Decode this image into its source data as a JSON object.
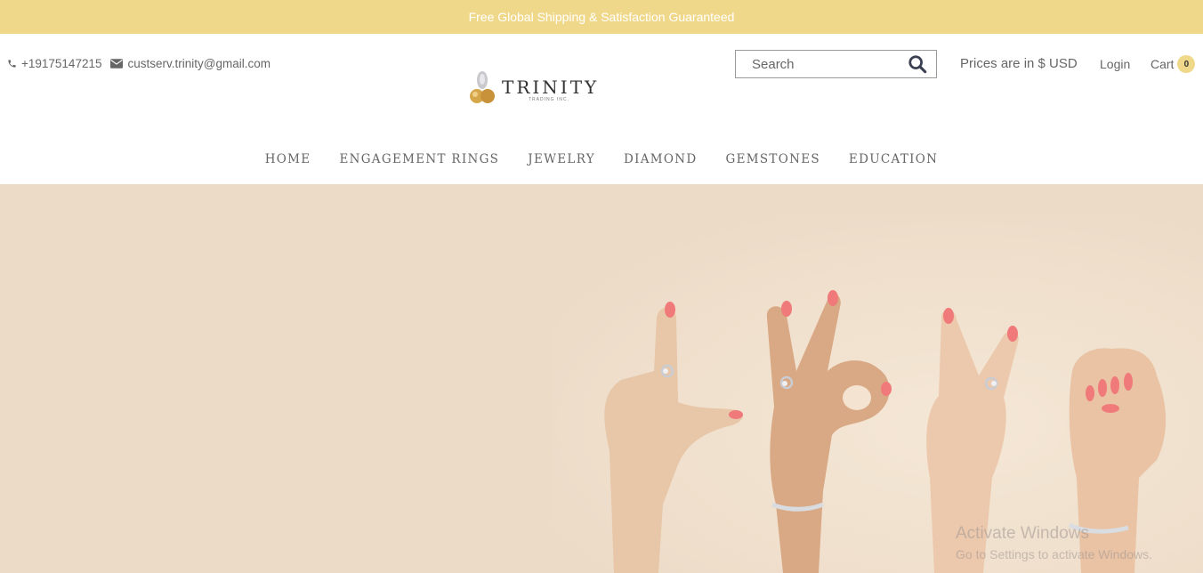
{
  "promo": {
    "text": "Free Global Shipping & Satisfaction Guaranteed"
  },
  "contact": {
    "phone": "+19175147215",
    "email": "custserv.trinity@gmail.com",
    "phone_icon": "phone-icon",
    "email_icon": "envelope-icon"
  },
  "logo": {
    "name": "TRINITY",
    "tagline": "TRADING INC."
  },
  "search": {
    "placeholder": "Search",
    "value": "",
    "icon": "search-icon"
  },
  "header": {
    "prices_label": "Prices are in $ USD",
    "login_label": "Login",
    "cart_label": "Cart",
    "cart_count": "0"
  },
  "nav": {
    "items": [
      {
        "label": "HOME"
      },
      {
        "label": "ENGAGEMENT RINGS"
      },
      {
        "label": "JEWELRY"
      },
      {
        "label": "DIAMOND"
      },
      {
        "label": "GEMSTONES"
      },
      {
        "label": "EDUCATION"
      }
    ]
  },
  "hero": {
    "image": "hands-spelling-love-with-rings"
  },
  "watermark": {
    "line1": "Activate Windows",
    "line2": "Go to Settings to activate Windows."
  },
  "colors": {
    "promo_bg": "#f0d88a",
    "hero_bg": "#ecdbc7",
    "cart_badge": "#f0d88a",
    "nail": "#f07a7a"
  }
}
